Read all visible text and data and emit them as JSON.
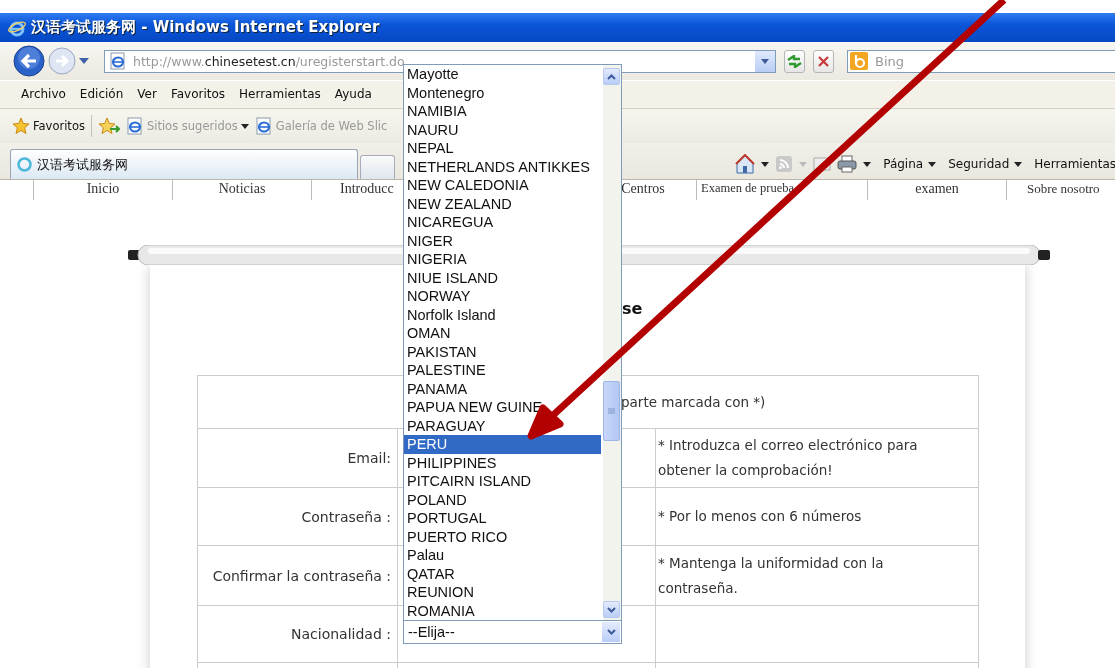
{
  "window": {
    "title": "汉语考试服务网 - Windows Internet Explorer"
  },
  "address_bar": {
    "url_parts": [
      {
        "text": "http://www.",
        "emphasis": false
      },
      {
        "text": "chinesetest.cn",
        "emphasis": true
      },
      {
        "text": "/uregisterstart.do",
        "emphasis": false
      }
    ]
  },
  "search": {
    "placeholder": "Bing"
  },
  "menu_bar": [
    "Archivo",
    "Edición",
    "Ver",
    "Favoritos",
    "Herramientas",
    "Ayuda"
  ],
  "favorites_bar": {
    "label": "Favoritos",
    "links": [
      {
        "label": "Sitios sugeridos",
        "dropdown": true
      },
      {
        "label": "Galería de Web Slic",
        "dropdown": false
      }
    ]
  },
  "tabs": [
    {
      "label": "汉语考试服务网",
      "selected": true
    }
  ],
  "command_bar": [
    "Página",
    "Seguridad",
    "Herramientas"
  ],
  "site_nav": [
    "Inicio",
    "Noticias",
    "Introducc",
    "Centros",
    "Examen de prueba",
    "examen",
    "Sobre nosotro"
  ],
  "heading": "se",
  "form": {
    "note": "parte marcada con *)",
    "rows": [
      {
        "label": "Email:",
        "hint": "* Introduzca el correo electrónico para obtener la comprobación!"
      },
      {
        "label": "Contraseña :",
        "hint": "* Por lo menos con 6 números"
      },
      {
        "label": "Confirmar la contraseña :",
        "hint": "* Mantenga la uniformidad con la contraseña."
      },
      {
        "label": "Nacionalidad :"
      }
    ]
  },
  "nationality_select": {
    "value": "--Elija--",
    "expanded": true,
    "options": [
      {
        "label": "Mayotte",
        "selected": false
      },
      {
        "label": "Montenegro",
        "selected": false
      },
      {
        "label": "NAMIBIA",
        "selected": false
      },
      {
        "label": "NAURU",
        "selected": false
      },
      {
        "label": "NEPAL",
        "selected": false
      },
      {
        "label": "NETHERLANDS ANTIKKES",
        "selected": false
      },
      {
        "label": "NEW CALEDONIA",
        "selected": false
      },
      {
        "label": "NEW ZEALAND",
        "selected": false
      },
      {
        "label": "NICAREGUA",
        "selected": false
      },
      {
        "label": "NIGER",
        "selected": false
      },
      {
        "label": "NIGERIA",
        "selected": false
      },
      {
        "label": "NIUE ISLAND",
        "selected": false
      },
      {
        "label": "NORWAY",
        "selected": false
      },
      {
        "label": "Norfolk Island",
        "selected": false
      },
      {
        "label": "OMAN",
        "selected": false
      },
      {
        "label": "PAKISTAN",
        "selected": false
      },
      {
        "label": "PALESTINE",
        "selected": false
      },
      {
        "label": "PANAMA",
        "selected": false
      },
      {
        "label": "PAPUA NEW GUINE",
        "selected": false
      },
      {
        "label": "PARAGUAY",
        "selected": false
      },
      {
        "label": "PERU",
        "selected": true
      },
      {
        "label": "PHILIPPINES",
        "selected": false
      },
      {
        "label": "PITCAIRN ISLAND",
        "selected": false
      },
      {
        "label": "POLAND",
        "selected": false
      },
      {
        "label": "PORTUGAL",
        "selected": false
      },
      {
        "label": "PUERTO RICO",
        "selected": false
      },
      {
        "label": "Palau",
        "selected": false
      },
      {
        "label": "QATAR",
        "selected": false
      },
      {
        "label": "REUNION",
        "selected": false
      },
      {
        "label": "ROMANIA",
        "selected": false
      }
    ]
  }
}
